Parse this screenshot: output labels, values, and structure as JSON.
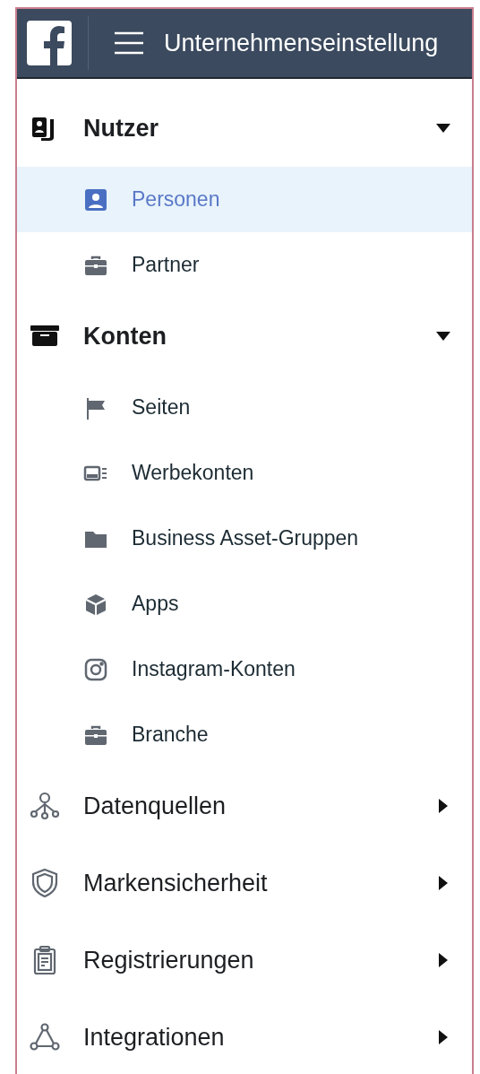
{
  "header": {
    "title": "Unternehmenseinstellung"
  },
  "sections": [
    {
      "label": "Nutzer",
      "expanded": true,
      "items": [
        {
          "label": "Personen",
          "selected": true
        },
        {
          "label": "Partner",
          "selected": false
        }
      ]
    },
    {
      "label": "Konten",
      "expanded": true,
      "items": [
        {
          "label": "Seiten",
          "selected": false
        },
        {
          "label": "Werbekonten",
          "selected": false
        },
        {
          "label": "Business Asset-Gruppen",
          "selected": false
        },
        {
          "label": "Apps",
          "selected": false
        },
        {
          "label": "Instagram-Konten",
          "selected": false
        },
        {
          "label": "Branche",
          "selected": false
        }
      ]
    },
    {
      "label": "Datenquellen",
      "expanded": false
    },
    {
      "label": "Markensicherheit",
      "expanded": false
    },
    {
      "label": "Registrierungen",
      "expanded": false
    },
    {
      "label": "Integrationen",
      "expanded": false
    }
  ]
}
